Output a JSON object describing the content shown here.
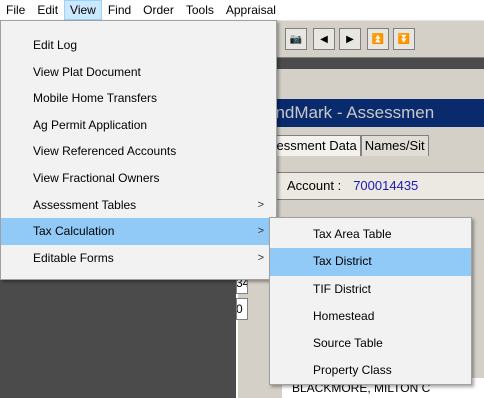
{
  "menubar": [
    {
      "label": "File",
      "active": false
    },
    {
      "label": "Edit",
      "active": false
    },
    {
      "label": "View",
      "active": true
    },
    {
      "label": "Find",
      "active": false
    },
    {
      "label": "Order",
      "active": false
    },
    {
      "label": "Tools",
      "active": false
    },
    {
      "label": "Appraisal",
      "active": false
    }
  ],
  "toolbar": {
    "buttons": [
      {
        "icon": "camera-icon",
        "glyph": "📷"
      },
      {
        "icon": "arrow-left-icon",
        "glyph": "◀"
      },
      {
        "icon": "arrow-right-icon",
        "glyph": "▶"
      },
      {
        "icon": "arrow-first-icon",
        "glyph": "⏫"
      },
      {
        "icon": "arrow-last-icon",
        "glyph": "⏬"
      }
    ]
  },
  "window": {
    "title": "andMark - Assessmen",
    "tabs": [
      "sessment Data",
      "Names/Sit"
    ],
    "account_label": "Account :",
    "account_value": "700014435",
    "field_fragment_1": "34",
    "field_fragment_2": "0",
    "bottom_name": "BLACKMORE, MILTON C"
  },
  "view_menu": {
    "items": [
      {
        "label": "Edit Log",
        "submenu": false,
        "highlighted": false
      },
      {
        "label": "View Plat Document",
        "submenu": false,
        "highlighted": false
      },
      {
        "label": "Mobile Home Transfers",
        "submenu": false,
        "highlighted": false
      },
      {
        "label": "Ag Permit Application",
        "submenu": false,
        "highlighted": false
      },
      {
        "label": "View Referenced Accounts",
        "submenu": false,
        "highlighted": false
      },
      {
        "label": "View Fractional Owners",
        "submenu": false,
        "highlighted": false
      },
      {
        "label": "Assessment Tables",
        "submenu": true,
        "highlighted": false
      },
      {
        "label": "Tax Calculation",
        "submenu": true,
        "highlighted": true
      },
      {
        "label": "Editable Forms",
        "submenu": true,
        "highlighted": false
      }
    ],
    "submenu_arrow": ">"
  },
  "tax_calculation_submenu": {
    "items": [
      {
        "label": "Tax Area Table",
        "highlighted": false
      },
      {
        "label": "Tax District",
        "highlighted": true
      },
      {
        "label": "TIF District",
        "highlighted": false
      },
      {
        "label": "Homestead",
        "highlighted": false
      },
      {
        "label": "Source Table",
        "highlighted": false
      },
      {
        "label": "Property Class",
        "highlighted": false
      }
    ]
  },
  "colors": {
    "highlight": "#91c9f7",
    "title_bar": "#0a2a6e",
    "account_value": "#1a1ab0"
  }
}
